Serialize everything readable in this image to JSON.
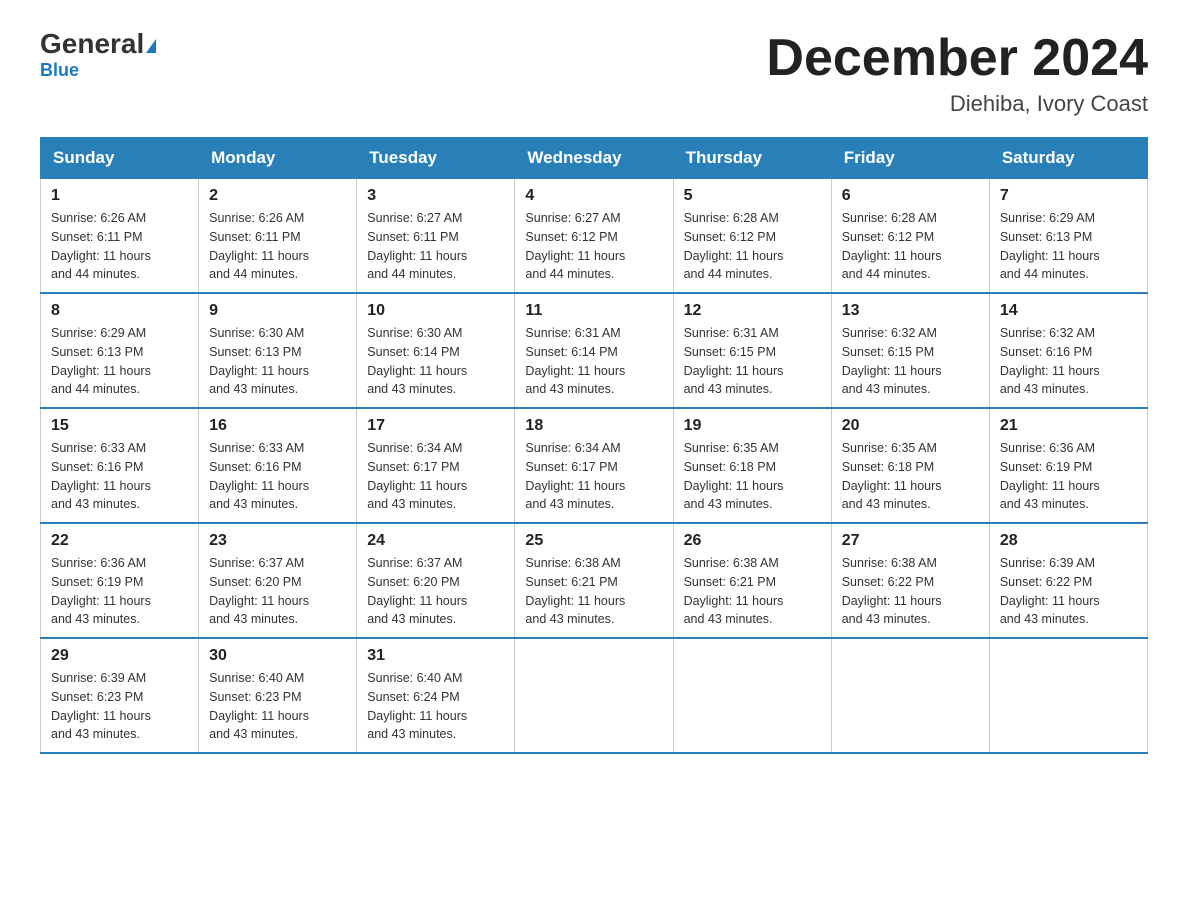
{
  "header": {
    "logo_main": "General",
    "logo_sub": "Blue",
    "month_title": "December 2024",
    "location": "Diehiba, Ivory Coast"
  },
  "days_of_week": [
    "Sunday",
    "Monday",
    "Tuesday",
    "Wednesday",
    "Thursday",
    "Friday",
    "Saturday"
  ],
  "weeks": [
    [
      {
        "day": "1",
        "sunrise": "6:26 AM",
        "sunset": "6:11 PM",
        "daylight": "11 hours and 44 minutes."
      },
      {
        "day": "2",
        "sunrise": "6:26 AM",
        "sunset": "6:11 PM",
        "daylight": "11 hours and 44 minutes."
      },
      {
        "day": "3",
        "sunrise": "6:27 AM",
        "sunset": "6:11 PM",
        "daylight": "11 hours and 44 minutes."
      },
      {
        "day": "4",
        "sunrise": "6:27 AM",
        "sunset": "6:12 PM",
        "daylight": "11 hours and 44 minutes."
      },
      {
        "day": "5",
        "sunrise": "6:28 AM",
        "sunset": "6:12 PM",
        "daylight": "11 hours and 44 minutes."
      },
      {
        "day": "6",
        "sunrise": "6:28 AM",
        "sunset": "6:12 PM",
        "daylight": "11 hours and 44 minutes."
      },
      {
        "day": "7",
        "sunrise": "6:29 AM",
        "sunset": "6:13 PM",
        "daylight": "11 hours and 44 minutes."
      }
    ],
    [
      {
        "day": "8",
        "sunrise": "6:29 AM",
        "sunset": "6:13 PM",
        "daylight": "11 hours and 44 minutes."
      },
      {
        "day": "9",
        "sunrise": "6:30 AM",
        "sunset": "6:13 PM",
        "daylight": "11 hours and 43 minutes."
      },
      {
        "day": "10",
        "sunrise": "6:30 AM",
        "sunset": "6:14 PM",
        "daylight": "11 hours and 43 minutes."
      },
      {
        "day": "11",
        "sunrise": "6:31 AM",
        "sunset": "6:14 PM",
        "daylight": "11 hours and 43 minutes."
      },
      {
        "day": "12",
        "sunrise": "6:31 AM",
        "sunset": "6:15 PM",
        "daylight": "11 hours and 43 minutes."
      },
      {
        "day": "13",
        "sunrise": "6:32 AM",
        "sunset": "6:15 PM",
        "daylight": "11 hours and 43 minutes."
      },
      {
        "day": "14",
        "sunrise": "6:32 AM",
        "sunset": "6:16 PM",
        "daylight": "11 hours and 43 minutes."
      }
    ],
    [
      {
        "day": "15",
        "sunrise": "6:33 AM",
        "sunset": "6:16 PM",
        "daylight": "11 hours and 43 minutes."
      },
      {
        "day": "16",
        "sunrise": "6:33 AM",
        "sunset": "6:16 PM",
        "daylight": "11 hours and 43 minutes."
      },
      {
        "day": "17",
        "sunrise": "6:34 AM",
        "sunset": "6:17 PM",
        "daylight": "11 hours and 43 minutes."
      },
      {
        "day": "18",
        "sunrise": "6:34 AM",
        "sunset": "6:17 PM",
        "daylight": "11 hours and 43 minutes."
      },
      {
        "day": "19",
        "sunrise": "6:35 AM",
        "sunset": "6:18 PM",
        "daylight": "11 hours and 43 minutes."
      },
      {
        "day": "20",
        "sunrise": "6:35 AM",
        "sunset": "6:18 PM",
        "daylight": "11 hours and 43 minutes."
      },
      {
        "day": "21",
        "sunrise": "6:36 AM",
        "sunset": "6:19 PM",
        "daylight": "11 hours and 43 minutes."
      }
    ],
    [
      {
        "day": "22",
        "sunrise": "6:36 AM",
        "sunset": "6:19 PM",
        "daylight": "11 hours and 43 minutes."
      },
      {
        "day": "23",
        "sunrise": "6:37 AM",
        "sunset": "6:20 PM",
        "daylight": "11 hours and 43 minutes."
      },
      {
        "day": "24",
        "sunrise": "6:37 AM",
        "sunset": "6:20 PM",
        "daylight": "11 hours and 43 minutes."
      },
      {
        "day": "25",
        "sunrise": "6:38 AM",
        "sunset": "6:21 PM",
        "daylight": "11 hours and 43 minutes."
      },
      {
        "day": "26",
        "sunrise": "6:38 AM",
        "sunset": "6:21 PM",
        "daylight": "11 hours and 43 minutes."
      },
      {
        "day": "27",
        "sunrise": "6:38 AM",
        "sunset": "6:22 PM",
        "daylight": "11 hours and 43 minutes."
      },
      {
        "day": "28",
        "sunrise": "6:39 AM",
        "sunset": "6:22 PM",
        "daylight": "11 hours and 43 minutes."
      }
    ],
    [
      {
        "day": "29",
        "sunrise": "6:39 AM",
        "sunset": "6:23 PM",
        "daylight": "11 hours and 43 minutes."
      },
      {
        "day": "30",
        "sunrise": "6:40 AM",
        "sunset": "6:23 PM",
        "daylight": "11 hours and 43 minutes."
      },
      {
        "day": "31",
        "sunrise": "6:40 AM",
        "sunset": "6:24 PM",
        "daylight": "11 hours and 43 minutes."
      },
      null,
      null,
      null,
      null
    ]
  ],
  "labels": {
    "sunrise": "Sunrise:",
    "sunset": "Sunset:",
    "daylight": "Daylight:"
  }
}
